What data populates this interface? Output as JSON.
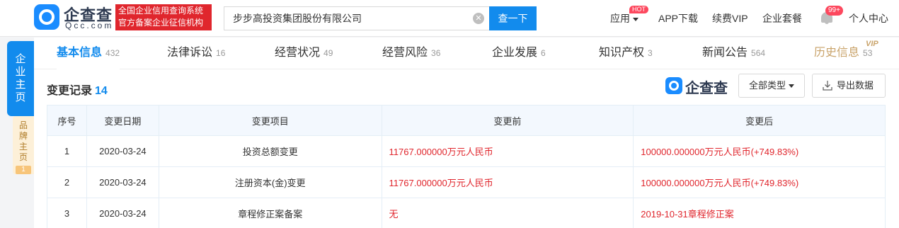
{
  "header": {
    "logo_cn": "企查查",
    "logo_en": "Qcc.com",
    "badge_line1": "全国企业信用查询系统",
    "badge_line2": "官方备案企业征信机构",
    "search_value": "步步高投资集团股份有限公司",
    "search_button": "查一下",
    "nav": {
      "apps": "应用",
      "hot": "HOT",
      "app_download": "APP下载",
      "vip": "续费VIP",
      "enterprise": "企业套餐",
      "msg_count": "99+",
      "user_center": "个人中心"
    }
  },
  "side": {
    "main_label": "企业主页",
    "brand_label": "品牌主页",
    "brand_count": "1"
  },
  "tabs": [
    {
      "label": "基本信息",
      "count": "432"
    },
    {
      "label": "法律诉讼",
      "count": "16"
    },
    {
      "label": "经营状况",
      "count": "49"
    },
    {
      "label": "经营风险",
      "count": "36"
    },
    {
      "label": "企业发展",
      "count": "6"
    },
    {
      "label": "知识产权",
      "count": "3"
    },
    {
      "label": "新闻公告",
      "count": "564"
    },
    {
      "label": "历史信息",
      "count": "53"
    }
  ],
  "vip_tag": "VIP",
  "section": {
    "title": "变更记录",
    "count": "14",
    "watermark": "企查查",
    "filter_label": "全部类型",
    "export_label": "导出数据"
  },
  "table": {
    "headers": [
      "序号",
      "变更日期",
      "变更项目",
      "变更前",
      "变更后"
    ],
    "rows": [
      {
        "no": "1",
        "date": "2020-03-24",
        "item": "投资总额变更",
        "before": "11767.000000万元人民币",
        "after": "100000.000000万元人民币(+749.83%)"
      },
      {
        "no": "2",
        "date": "2020-03-24",
        "item": "注册资本(金)变更",
        "before": "11767.000000万元人民币",
        "after": "100000.000000万元人民币(+749.83%)"
      },
      {
        "no": "3",
        "date": "2020-03-24",
        "item": "章程修正案备案",
        "before": "无",
        "after": "2019-10-31章程修正案"
      }
    ]
  }
}
